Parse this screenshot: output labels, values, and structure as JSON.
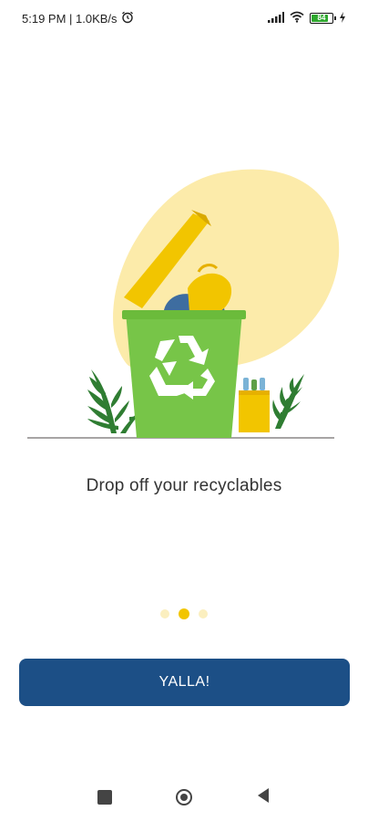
{
  "status_bar": {
    "time_speed": "5:19 PM | 1.0KB/s",
    "alarm_icon": "alarm-icon",
    "signal_icon": "signal-icon",
    "wifi_icon": "wifi-icon",
    "battery_level": "84",
    "battery_fraction": 0.84,
    "charging_icon": "bolt-icon"
  },
  "onboarding": {
    "caption": "Drop off your recyclables",
    "page_index": 2,
    "page_count": 3,
    "button_label": "YALLA!"
  },
  "colors": {
    "accent_yellow": "#f2c500",
    "bin_green": "#77c548",
    "button_blue": "#1c4f86"
  },
  "nav_bar": {
    "recents_icon": "square-icon",
    "home_icon": "circle-home-icon",
    "back_icon": "back-triangle-icon"
  }
}
